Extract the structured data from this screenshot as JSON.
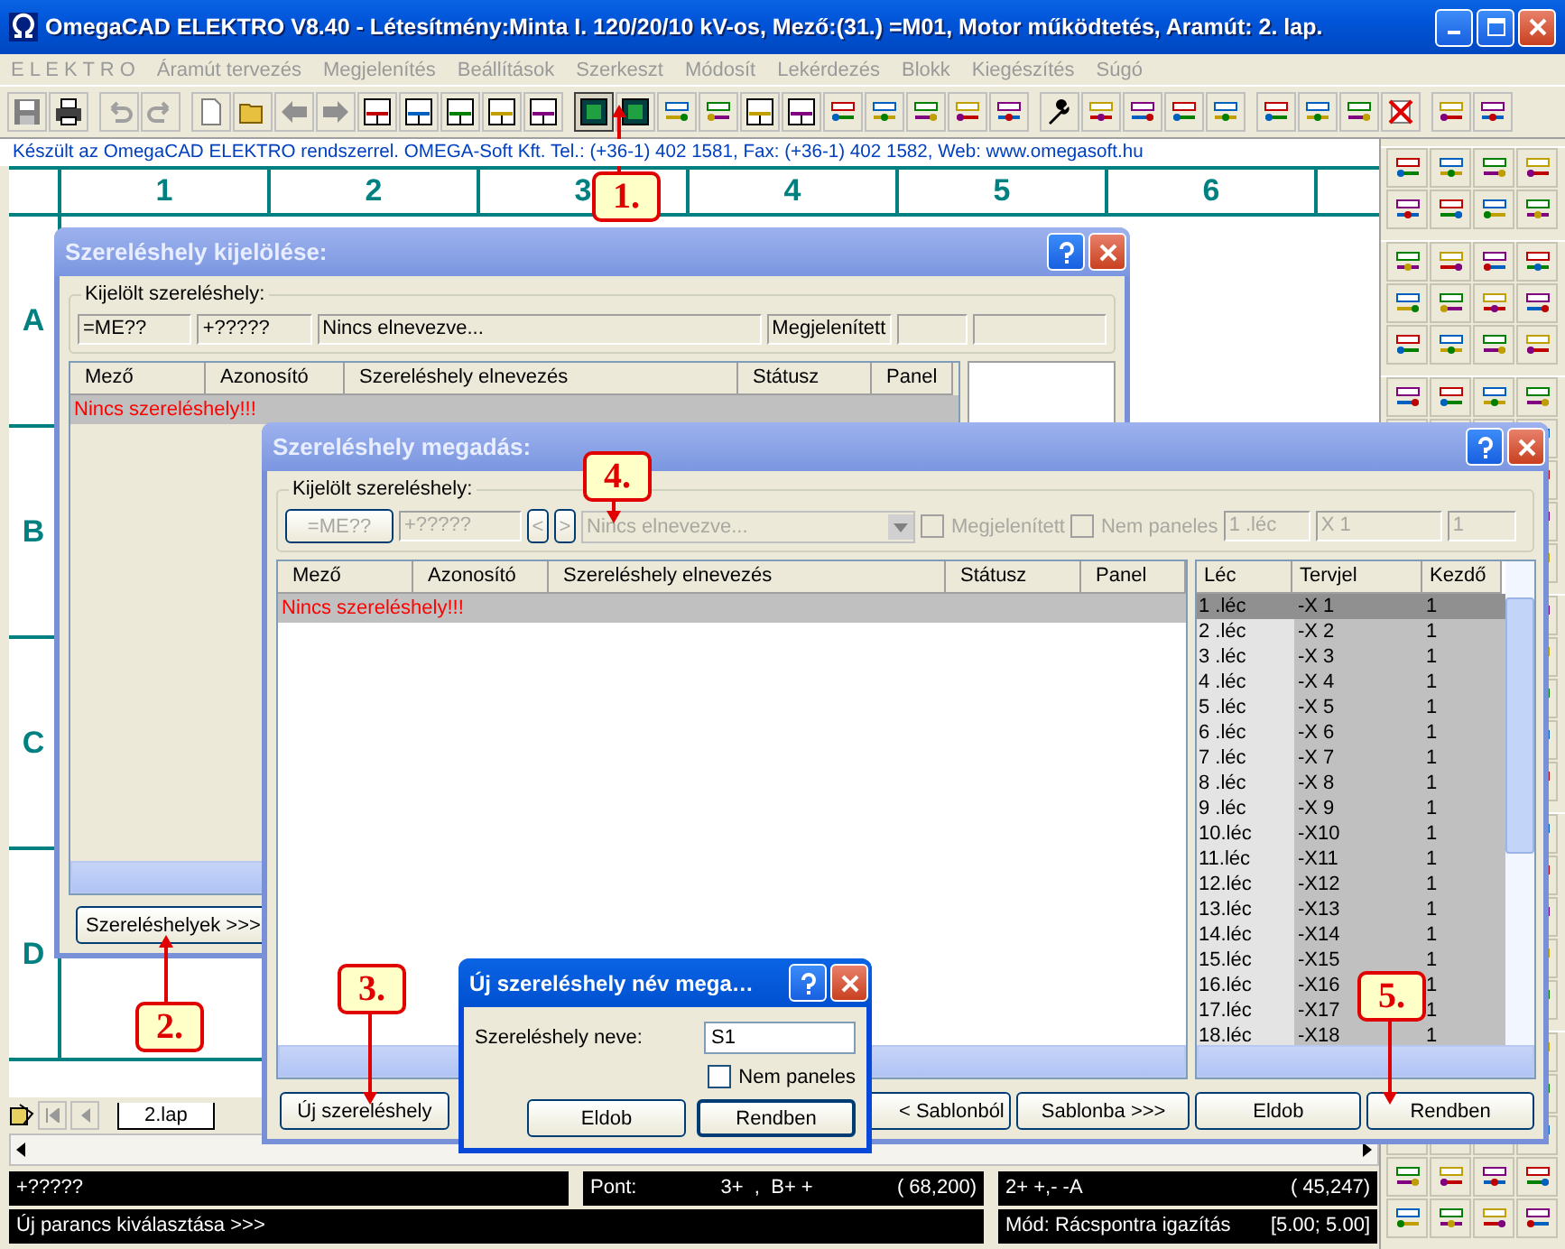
{
  "window": {
    "title": "OmegaCAD ELEKTRO V8.40 - Létesítmény:Minta I. 120/20/10 kV-os, Mező:(31.) =M01, Motor működtetés, Aramút:  2. lap."
  },
  "menu": [
    "E L E K T R O",
    "Áramút tervezés",
    "Megjelenítés",
    "Beállítások",
    "Szerkeszt",
    "Módosít",
    "Lekérdezés",
    "Blokk",
    "Kiegészítés",
    "Súgó"
  ],
  "info_line": "Készült az OmegaCAD ELEKTRO rendszerrel. OMEGA-Soft Kft. Tel.: (+36-1) 402 1581, Fax: (+36-1) 402 1582, Web: www.omegasoft.hu",
  "sheet": {
    "columns": [
      "1",
      "2",
      "3",
      "4",
      "5",
      "6"
    ],
    "rows": [
      "A",
      "B",
      "C",
      "D"
    ]
  },
  "dialog_select": {
    "title": "Szereléshely kijelölése:",
    "active": false,
    "group_label": "Kijelölt szereléshely:",
    "fields": [
      "=ME??",
      "+?????",
      "Nincs elnevezve...",
      "Megjelenített"
    ],
    "columns": [
      "Mező",
      "Azonosító",
      "Szereléshely elnevezés",
      "Státusz",
      "Panel"
    ],
    "empty_message": "Nincs szereléshely!!!",
    "button": "Szereléshelyek >>>"
  },
  "dialog_define": {
    "title": "Szereléshely megadás:",
    "active": false,
    "group_label": "Kijelölt szereléshely:",
    "disabled": true,
    "field_mezo": "=ME??",
    "field_id": "+?????",
    "prev": "<",
    "next": ">",
    "field_name": "Nincs elnevezve...",
    "checkboxes": [
      {
        "label": "Megjelenített",
        "checked": false
      },
      {
        "label": "Nem paneles",
        "checked": false
      }
    ],
    "field_strip": "1 .léc",
    "field_tag": "X 1",
    "field_start": "1",
    "columns": [
      "Mező",
      "Azonosító",
      "Szereléshely elnevezés",
      "Státusz",
      "Panel"
    ],
    "empty_message": "Nincs szereléshely!!!",
    "strip_columns": [
      "Léc",
      "Tervjel",
      "Kezdő"
    ],
    "strips": [
      {
        "lec": "1 .léc",
        "tag": "-X 1",
        "start": "1",
        "selected": true
      },
      {
        "lec": "2 .léc",
        "tag": "-X 2",
        "start": "1",
        "selected": false
      },
      {
        "lec": "3 .léc",
        "tag": "-X 3",
        "start": "1",
        "selected": false
      },
      {
        "lec": "4 .léc",
        "tag": "-X 4",
        "start": "1",
        "selected": false
      },
      {
        "lec": "5 .léc",
        "tag": "-X 5",
        "start": "1",
        "selected": false
      },
      {
        "lec": "6 .léc",
        "tag": "-X 6",
        "start": "1",
        "selected": false
      },
      {
        "lec": "7 .léc",
        "tag": "-X 7",
        "start": "1",
        "selected": false
      },
      {
        "lec": "8 .léc",
        "tag": "-X 8",
        "start": "1",
        "selected": false
      },
      {
        "lec": "9 .léc",
        "tag": "-X 9",
        "start": "1",
        "selected": false
      },
      {
        "lec": "10.léc",
        "tag": "-X10",
        "start": "1",
        "selected": false
      },
      {
        "lec": "11.léc",
        "tag": "-X11",
        "start": "1",
        "selected": false
      },
      {
        "lec": "12.léc",
        "tag": "-X12",
        "start": "1",
        "selected": false
      },
      {
        "lec": "13.léc",
        "tag": "-X13",
        "start": "1",
        "selected": false
      },
      {
        "lec": "14.léc",
        "tag": "-X14",
        "start": "1",
        "selected": false
      },
      {
        "lec": "15.léc",
        "tag": "-X15",
        "start": "1",
        "selected": false
      },
      {
        "lec": "16.léc",
        "tag": "-X16",
        "start": "1",
        "selected": false
      },
      {
        "lec": "17.léc",
        "tag": "-X17",
        "start": "1",
        "selected": false
      },
      {
        "lec": "18.léc",
        "tag": "-X18",
        "start": "1",
        "selected": false
      }
    ],
    "buttons": [
      "Új szereléshely",
      "< Sablonból",
      "Sablonba >>>",
      "Eldob",
      "Rendben"
    ]
  },
  "dialog_new": {
    "title": "Új szereléshely név mega…",
    "active": true,
    "label": "Szereléshely neve:",
    "value": "S1",
    "checkbox": {
      "label": "Nem paneles",
      "checked": false
    },
    "buttons": [
      "Eldob",
      "Rendben"
    ]
  },
  "sheet_tabs": [
    {
      "label": "2.lap",
      "selected": true
    }
  ],
  "status": {
    "prompt": "+?????",
    "point_label": "Pont:",
    "point_value": "3+  ,  B+ +",
    "point_coords": "( 68,200)",
    "cursor_value": "2+ +,- -A",
    "cursor_coords": "( 45,247)",
    "command": "Új parancs kiválasztása >>>",
    "mode": "Mód: Rácspontra igazítás",
    "grid": "[5.00; 5.00]"
  },
  "callouts": [
    {
      "label": "1."
    },
    {
      "label": "2."
    },
    {
      "label": "3."
    },
    {
      "label": "4."
    },
    {
      "label": "5."
    }
  ]
}
